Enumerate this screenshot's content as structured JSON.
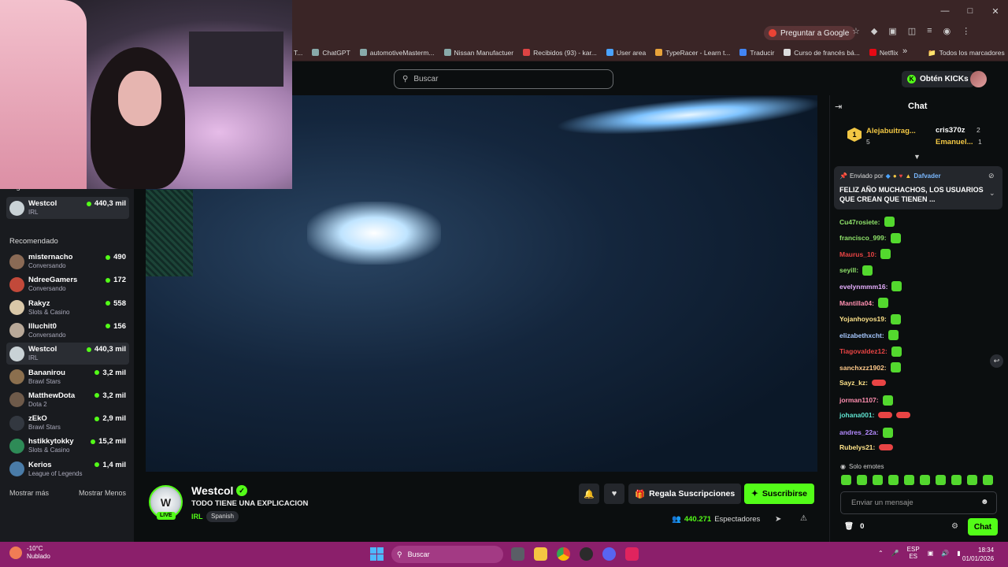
{
  "browser": {
    "ask_google": "Preguntar a Google",
    "bookmarks": [
      "T...",
      "ChatGPT",
      "automotiveMasterm...",
      "Nissan Manufactuer",
      "Recibidos (93) - kar...",
      "User area",
      "TypeRacer - Learn t...",
      "Traducir",
      "Curso de francés bá...",
      "Netflix"
    ],
    "all_bookmarks": "Todos los marcadores",
    "more_bookmarks": "»"
  },
  "header": {
    "search_placeholder": "Buscar",
    "get_kicks": "Obtén KICKs"
  },
  "sidebar": {
    "following_title": "Siguiendo",
    "following": [
      {
        "name": "Westcol",
        "category": "IRL",
        "viewers": "440,3 mil",
        "color": "#c9d2d6"
      }
    ],
    "recommended_title": "Recomendado",
    "recommended": [
      {
        "name": "misternacho",
        "category": "Conversando",
        "viewers": "490",
        "color": "#8a6a55"
      },
      {
        "name": "NdreeGamers",
        "category": "Conversando",
        "viewers": "172",
        "color": "#c2493a"
      },
      {
        "name": "Rakyz",
        "category": "Slots & Casino",
        "viewers": "558",
        "color": "#d9c7a8"
      },
      {
        "name": "Illuchit0",
        "category": "Conversando",
        "viewers": "156",
        "color": "#b8a898"
      },
      {
        "name": "Westcol",
        "category": "IRL",
        "viewers": "440,3 mil",
        "color": "#c9d2d6"
      },
      {
        "name": "Bananirou",
        "category": "Brawl Stars",
        "viewers": "3,2 mil",
        "color": "#8b6f4e"
      },
      {
        "name": "MatthewDota",
        "category": "Dota 2",
        "viewers": "3,2 mil",
        "color": "#6e5a4a"
      },
      {
        "name": "zEkO",
        "category": "Brawl Stars",
        "viewers": "2,9 mil",
        "color": "#333840"
      },
      {
        "name": "hstikkytokky",
        "category": "Slots & Casino",
        "viewers": "15,2 mil",
        "color": "#2e8b57"
      },
      {
        "name": "Kerios",
        "category": "League of Legends",
        "viewers": "1,4 mil",
        "color": "#4a7ca8"
      }
    ],
    "show_more": "Mostrar más",
    "show_less": "Mostrar Menos"
  },
  "stream": {
    "channel": "Westcol",
    "live": "LIVE",
    "title": "TODO TIENE UNA EXPLICACION",
    "category": "IRL",
    "tag": "Spanish",
    "gift_label": "Regala Suscripciones",
    "subscribe_label": "Suscribirse",
    "viewers": "440.271",
    "viewers_label": "Espectadores"
  },
  "chat": {
    "title": "Chat",
    "leaderboard": [
      {
        "name": "Alejabuitrag...",
        "count": "5",
        "color": "#f2c744"
      },
      {
        "name": "cris370z",
        "count": "2",
        "color": "#ffffff"
      },
      {
        "name": "Emanuel...",
        "count": "1",
        "color": "#f2c744"
      }
    ],
    "pinned": {
      "sent_by": "Enviado por",
      "author": "Dafvader",
      "text": "FELIZ AÑO MUCHACHOS, LOS USUARIOS QUE CREAN QUE TIENEN ..."
    },
    "messages": [
      {
        "user": "Cu47rosiete:",
        "color": "#8fe36a",
        "emotes": 1,
        "red": false
      },
      {
        "user": "francisco_999:",
        "color": "#8fe36a",
        "emotes": 1,
        "red": false
      },
      {
        "user": "Maurus_10:",
        "color": "#e84444",
        "emotes": 1,
        "red": false
      },
      {
        "user": "seyill:",
        "color": "#8fe36a",
        "emotes": 1,
        "red": false
      },
      {
        "user": "evelynmmm16:",
        "color": "#e7b0ff",
        "emotes": 1,
        "red": false
      },
      {
        "user": "Mantilla04:",
        "color": "#ff8fb0",
        "emotes": 1,
        "red": false
      },
      {
        "user": "Yojanhoyos19:",
        "color": "#ffe38a",
        "emotes": 1,
        "red": false
      },
      {
        "user": "elizabethxcht:",
        "color": "#a6c8ff",
        "emotes": 1,
        "red": false
      },
      {
        "user": "Tiagovaldez12:",
        "color": "#e84444",
        "emotes": 1,
        "red": false
      },
      {
        "user": "sanchxzz1902:",
        "color": "#ffc98a",
        "emotes": 1,
        "red": false
      },
      {
        "user": "Sayz_kz:",
        "color": "#ffe38a",
        "emotes": 1,
        "red": true
      },
      {
        "user": "jorman1107:",
        "color": "#ff8fb0",
        "emotes": 1,
        "red": false
      },
      {
        "user": "johana001:",
        "color": "#5fe3d0",
        "emotes": 2,
        "red": true
      },
      {
        "user": "andres_22a:",
        "color": "#b48aff",
        "emotes": 1,
        "red": false
      },
      {
        "user": "Rubelys21:",
        "color": "#ffe38a",
        "emotes": 1,
        "red": true
      }
    ],
    "emote_only": "Solo emotes",
    "input_placeholder": "Enviar un mensaje",
    "kicks": "0",
    "send_label": "Chat"
  },
  "taskbar": {
    "temp": "-10°C",
    "weather": "Nublado",
    "search": "Buscar",
    "lang_top": "ESP",
    "lang_bottom": "ES",
    "time": "18:34",
    "date": "01/01/2026"
  },
  "colors": {
    "accent": "#53fc18",
    "taskbar": "#8b1f6b",
    "browser": "#3a2526"
  }
}
